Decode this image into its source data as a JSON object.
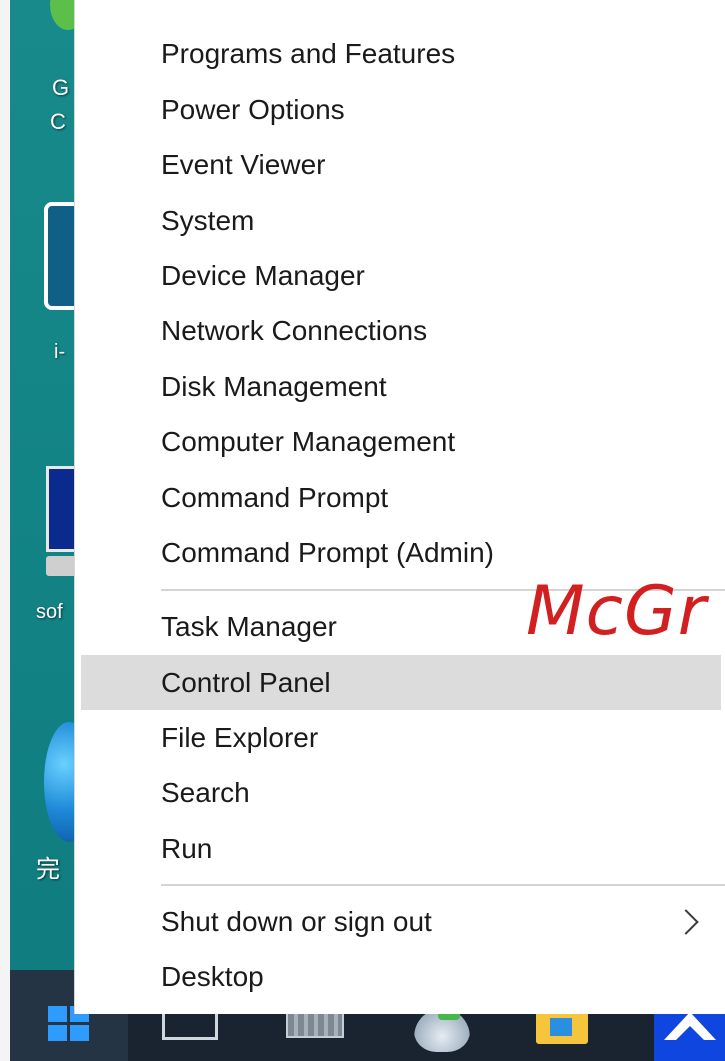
{
  "desktop": {
    "labels": {
      "g": "G",
      "c": "C",
      "i": "i-",
      "sof": "sof",
      "wan": "完"
    }
  },
  "menu": {
    "group1": [
      {
        "label": "Programs and Features"
      },
      {
        "label": "Power Options"
      },
      {
        "label": "Event Viewer"
      },
      {
        "label": "System"
      },
      {
        "label": "Device Manager"
      },
      {
        "label": "Network Connections"
      },
      {
        "label": "Disk Management"
      },
      {
        "label": "Computer Management"
      },
      {
        "label": "Command Prompt"
      },
      {
        "label": "Command Prompt (Admin)"
      }
    ],
    "group2": [
      {
        "label": "Task Manager"
      },
      {
        "label": "Control Panel",
        "highlighted": true
      },
      {
        "label": "File Explorer"
      },
      {
        "label": "Search"
      },
      {
        "label": "Run"
      }
    ],
    "group3": [
      {
        "label": "Shut down or sign out",
        "has_submenu": true
      },
      {
        "label": "Desktop"
      }
    ]
  },
  "watermark": {
    "text": "McGr"
  },
  "colors": {
    "desktop_bg": "#138486",
    "taskbar_bg": "#1a2430",
    "highlight_bg": "#dcdcdc",
    "watermark": "#d21f1f",
    "windows_logo": "#2e9bff"
  },
  "icons": {
    "start": "windows-logo-icon",
    "task_view": "task-view-icon",
    "keyboard": "keyboard-icon",
    "person": "person-icon",
    "folder": "file-explorer-folder-icon",
    "vnc": "vnc-arrow-icon",
    "submenu": "chevron-right-icon"
  }
}
